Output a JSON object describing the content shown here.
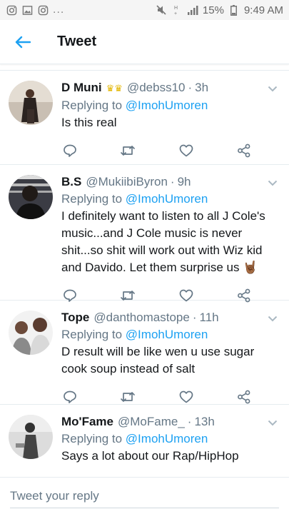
{
  "status_bar": {
    "dots": "...",
    "battery": "15%",
    "time": "9:49 AM"
  },
  "header": {
    "title": "Tweet"
  },
  "tweets": [
    {
      "name": "D Muni",
      "handle": "@debss10",
      "time": "3h",
      "replying_prefix": "Replying to",
      "replying_to": "@ImohUmoren",
      "text": "Is this real"
    },
    {
      "name": "B.S",
      "handle": "@MukiibiByron",
      "time": "9h",
      "replying_prefix": "Replying to",
      "replying_to": "@ImohUmoren",
      "text": "I definitely want to listen to all J Cole's music...and J Cole music is never shit...so shit will work out with Wiz kid and Davido. Let them surprise us 🤘🏾"
    },
    {
      "name": "Tope",
      "handle": "@danthomastope",
      "time": "11h",
      "replying_prefix": "Replying to",
      "replying_to": "@ImohUmoren",
      "text": "D result will be like wen u use sugar cook soup instead of salt"
    },
    {
      "name": "Mo'Fame",
      "handle": "@MoFame_",
      "time": "13h",
      "replying_prefix": "Replying to",
      "replying_to": "@ImohUmoren",
      "text": "Says a lot about our Rap/HipHop"
    }
  ],
  "composer": {
    "placeholder": "Tweet your reply"
  },
  "colors": {
    "accent": "#1da1f2",
    "secondary_text": "#657786",
    "divider": "#e6ecf0"
  }
}
